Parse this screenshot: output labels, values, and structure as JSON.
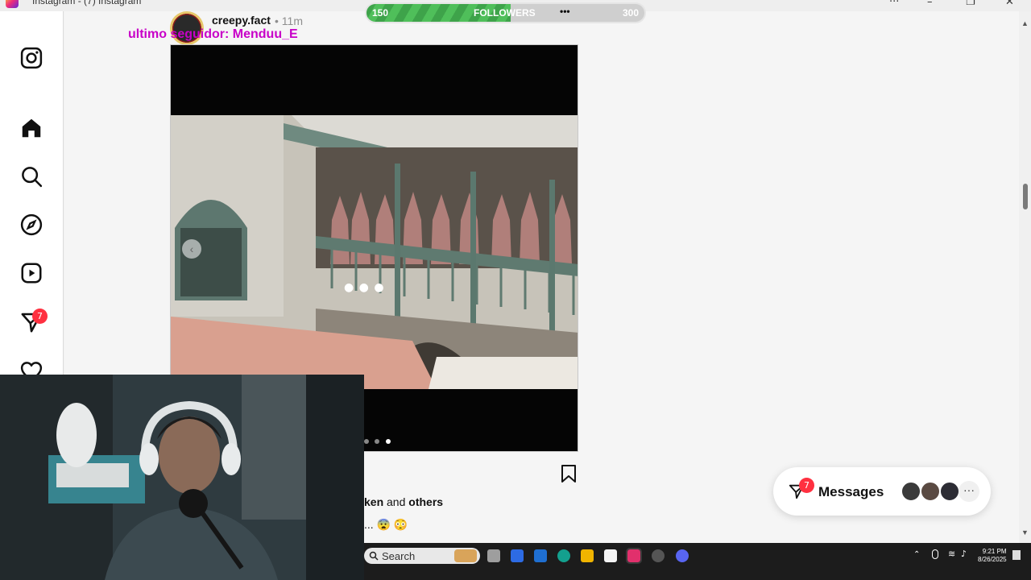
{
  "window": {
    "title": "Instagram - (7) Instagram",
    "controls": {
      "more": "···",
      "minimize": "–",
      "restore": "❐",
      "close": "✕"
    }
  },
  "sidebar": {
    "items": [
      {
        "name": "instagram-logo-icon"
      },
      {
        "name": "home-icon"
      },
      {
        "name": "search-icon"
      },
      {
        "name": "explore-icon"
      },
      {
        "name": "reels-icon"
      },
      {
        "name": "messages-icon",
        "badge": "7"
      },
      {
        "name": "notifications-icon"
      }
    ]
  },
  "overlay": {
    "goal_label": "FOLLOWERS",
    "goal_start": "150",
    "goal_end": "300",
    "goal_progress": 0.52,
    "goal_menu": "•••",
    "last_follower": "ultimo seguidor: Menduu_E"
  },
  "post": {
    "username": "creepy.fact",
    "time": "• 11m",
    "carousel_prev": "‹",
    "carousel_total": 3,
    "carousel_active": 2,
    "loading_dots": "● ● ●",
    "liked_by_name": "ken",
    "liked_by_middle": " and ",
    "liked_by_others": "others",
    "caption_more": "... 😨 😳"
  },
  "messages_pill": {
    "label": "Messages",
    "badge": "7",
    "more": "···",
    "avatar_colors": [
      "#3a3a3a",
      "#5a4a42",
      "#2d2d35"
    ]
  },
  "taskbar": {
    "search_placeholder": "Search",
    "time": "9:21 PM",
    "date": "8/26/2025",
    "app_colors": [
      "#9e9e9e",
      "#2d6be4",
      "#1f6fd1",
      "#13a08e",
      "#f0b400",
      "#f4f4f4",
      "#e1306c",
      "#555555",
      "#5865f2"
    ]
  },
  "colors": {
    "overlay_magenta": "#c800c8",
    "badge_red": "#ff3040",
    "goal_green": "#4fbf5a"
  }
}
